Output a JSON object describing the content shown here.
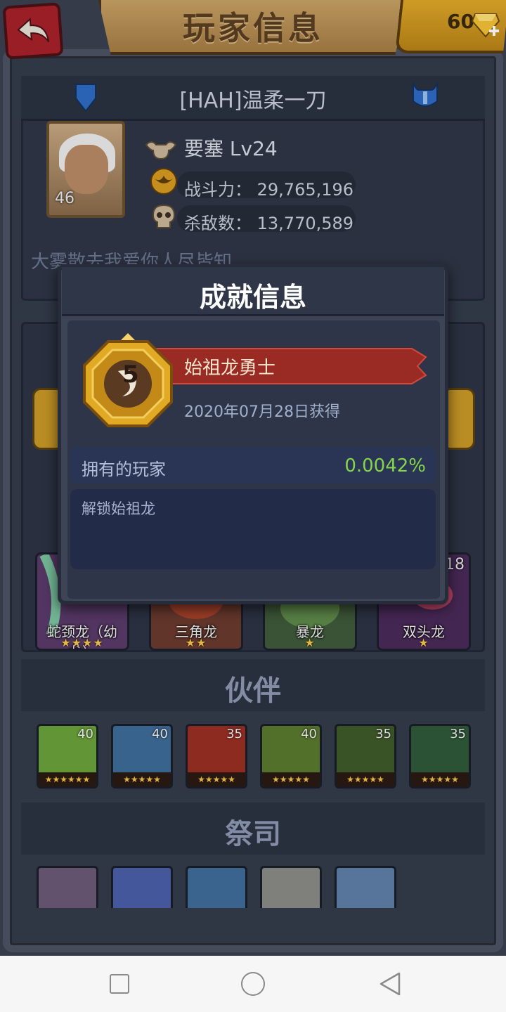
{
  "header": {
    "title": "玩家信息",
    "gem_count": "60",
    "back_icon": "back-arrow-icon",
    "gem_icon": "diamond-plus-icon"
  },
  "player": {
    "name": "[HAH]温柔一刀",
    "avatar_level": "46",
    "guild_line": "要塞 Lv24",
    "power_label": "战斗力：",
    "power_value": "29,765,196",
    "kills_label": "杀敌数：",
    "kills_value": "13,770,589",
    "description": "大雾散去我爱你人尽皆知"
  },
  "dragons": [
    {
      "name": "蛇颈龙（幼龙）",
      "stars": "★★★★"
    },
    {
      "name": "三角龙",
      "stars": "★★"
    },
    {
      "name": "暴龙",
      "stars": "★"
    },
    {
      "name": "双头龙",
      "stars": "★",
      "level": "18"
    }
  ],
  "sections": {
    "partners_title": "伙伴",
    "priests_title": "祭司"
  },
  "partners": [
    {
      "level": "40",
      "stars": "★★★★★★",
      "color": "#6aa23a"
    },
    {
      "level": "40",
      "stars": "★★★★★",
      "color": "#3d6c9a"
    },
    {
      "level": "35",
      "stars": "★★★★★",
      "color": "#9a2f24"
    },
    {
      "level": "40",
      "stars": "★★★★★",
      "color": "#5b7a2e"
    },
    {
      "level": "35",
      "stars": "★★★★★",
      "color": "#3e5a2a"
    },
    {
      "level": "35",
      "stars": "★★★★★",
      "color": "#2f5a3a"
    }
  ],
  "priests": [
    {
      "color": "#6b5a78"
    },
    {
      "color": "#4a5fa8"
    },
    {
      "color": "#3f6c9a"
    },
    {
      "color": "#8a8a86"
    },
    {
      "color": "#5f7fa8"
    }
  ],
  "dialog": {
    "title": "成就信息",
    "achievement_name": "始祖龙勇士",
    "achievement_date": "2020年07月28日获得",
    "owners_label": "拥有的玩家",
    "owners_value": "0.0042%",
    "description": "解锁始祖龙",
    "medal_icon": "gold-dragon-medal-icon",
    "ribbon_color": "#9a2a24",
    "value_color": "#83d64a"
  },
  "navbar": {
    "recent_icon": "square-recent-apps-icon",
    "home_icon": "circle-home-icon",
    "back_icon": "triangle-back-icon"
  }
}
